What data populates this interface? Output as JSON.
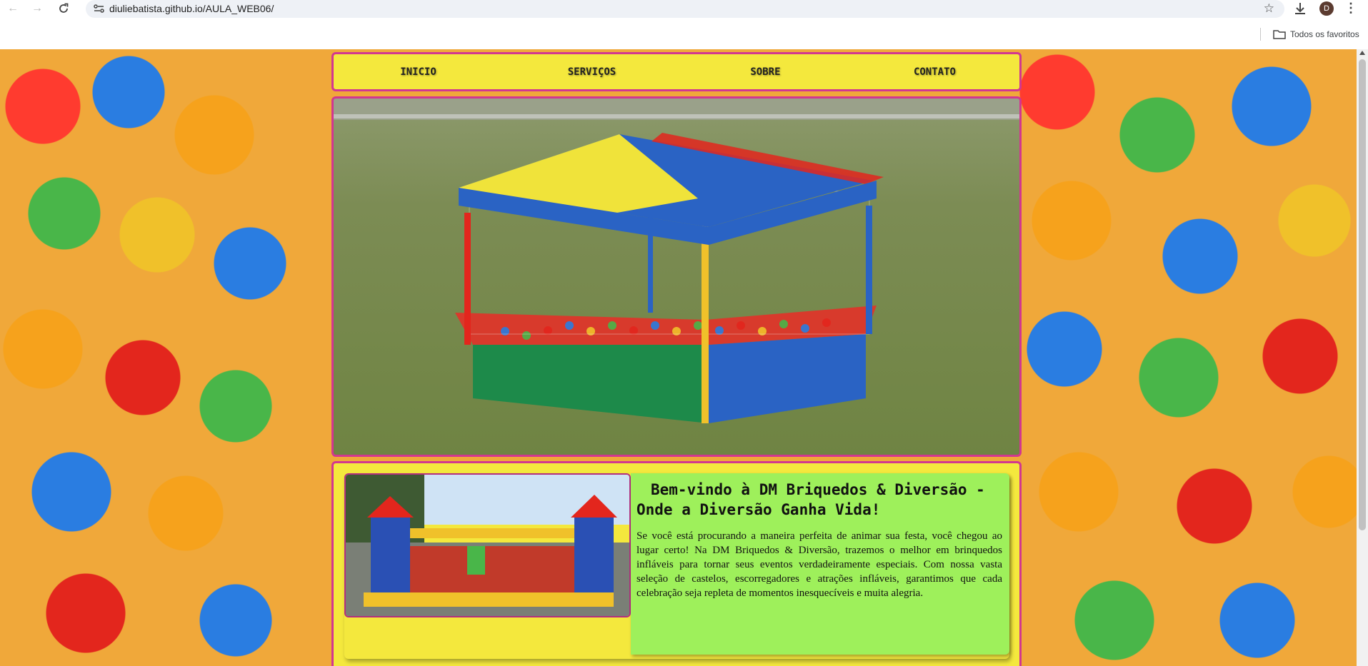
{
  "browser": {
    "url": "diuliebatista.github.io/AULA_WEB06/",
    "profile_initial": "D",
    "bookmarks_folder": "Todos os favoritos"
  },
  "site": {
    "nav": [
      "INICIO",
      "SERVIÇOS",
      "SOBRE",
      "CONTATO"
    ],
    "welcome_title": "Bem-vindo à DM Briquedos & Diversão - Onde a Diversão Ganha Vida!",
    "welcome_body": "Se você está procurando a maneira perfeita de animar sua festa, você chegou ao lugar certo! Na DM Briquedos & Diversão, trazemos o melhor em brinquedos infláveis para tornar seus eventos verdadeiramente especiais. Com nossa vasta seleção de castelos, escorregadores e atrações infláveis, garantimos que cada celebração seja repleta de momentos inesquecíveis e muita alegria."
  },
  "colors": {
    "nav_bg": "#f4e83d",
    "border_accent": "#d23790",
    "text_panel": "#9ef05b"
  },
  "icons": [
    "back-arrow-icon",
    "forward-arrow-icon",
    "reload-icon",
    "site-info-icon",
    "star-icon",
    "download-icon",
    "menu-kebab-icon",
    "folder-icon"
  ]
}
